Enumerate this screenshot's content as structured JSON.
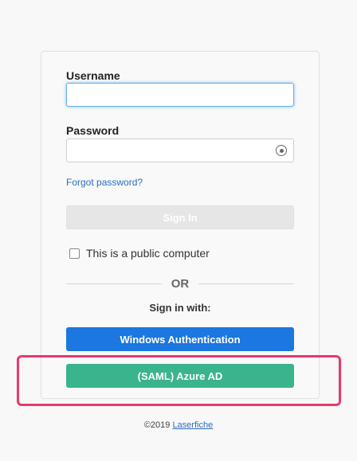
{
  "login": {
    "username_label": "Username",
    "username_value": "",
    "password_label": "Password",
    "password_value": "",
    "forgot_password": "Forgot password?",
    "signin_button": "Sign In",
    "public_computer_label": "This is a public computer",
    "public_computer_checked": false,
    "or_text": "OR",
    "sign_in_with": "Sign in with:",
    "windows_auth_button": "Windows Authentication",
    "saml_button": "(SAML) Azure AD"
  },
  "footer": {
    "copyright": "©2019",
    "brand_link": "Laserfiche"
  },
  "colors": {
    "windows_button": "#1c77e0",
    "saml_button": "#3ab48c",
    "highlight_box": "#e8396a",
    "link": "#2a6ebb",
    "signin_disabled": "#e6e6e6"
  },
  "icons": {
    "password_toggle": "eye-toggle-icon"
  }
}
